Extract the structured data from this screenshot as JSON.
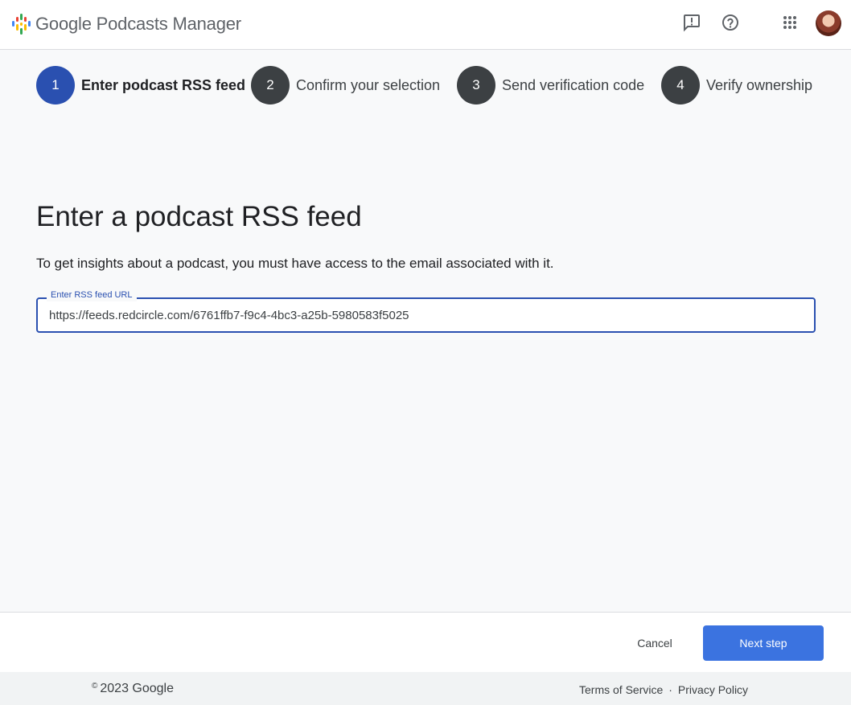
{
  "app": {
    "brand": "Google Podcasts Manager",
    "logo_colors": [
      "#4285f4",
      "#ea4335",
      "#fbbc04",
      "#34a853"
    ]
  },
  "topbar": {
    "icons": [
      "feedback-icon",
      "help-icon",
      "apps-grid-icon"
    ],
    "avatar": "account-avatar"
  },
  "stepper": {
    "steps": [
      {
        "number": "1",
        "label": "Enter podcast RSS feed",
        "active": true
      },
      {
        "number": "2",
        "label": "Confirm your selection",
        "active": false
      },
      {
        "number": "3",
        "label": "Send verification code",
        "active": false
      },
      {
        "number": "4",
        "label": "Verify ownership",
        "active": false
      }
    ]
  },
  "main": {
    "title": "Enter a podcast RSS feed",
    "description": "To get insights about a podcast, you must have access to the email associated with it.",
    "rss_field": {
      "label": "Enter RSS feed URL",
      "value": "https://feeds.redcircle.com/6761ffb7-f9c4-4bc3-a25b-5980583f5025"
    }
  },
  "actions": {
    "cancel_label": "Cancel",
    "next_label": "Next step"
  },
  "footer": {
    "copyright_symbol": "©",
    "copyright": "2023 Google",
    "terms": "Terms of Service",
    "separator": "·",
    "privacy": "Privacy Policy"
  },
  "colors": {
    "accent": "#2a50b0",
    "primary_button": "#3b73e0",
    "step_inactive": "#3c4043"
  }
}
